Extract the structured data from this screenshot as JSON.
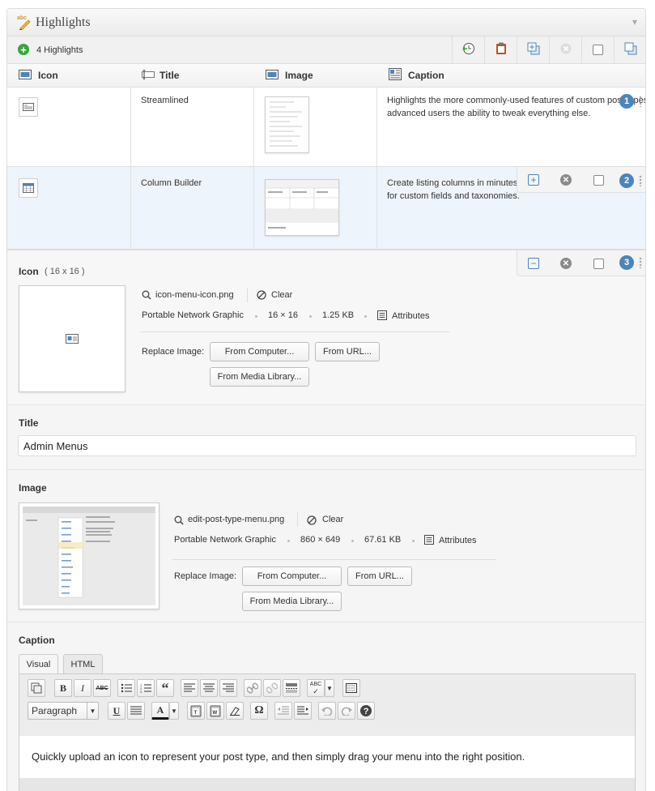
{
  "panel": {
    "title": "Highlights",
    "collapse_glyph": "▾",
    "title_icon": "pencil-icon"
  },
  "toolbar": {
    "add_glyph": "+",
    "count_label": "4 Highlights"
  },
  "columns": {
    "icon": "Icon",
    "title": "Title",
    "image": "Image",
    "caption": "Caption"
  },
  "rows": [
    {
      "number": "1",
      "title": "Streamlined",
      "caption": "Highlights the more commonly-used features of custom post types advanced users the ability to tweak everything else."
    },
    {
      "number": "2",
      "title": "Column Builder",
      "caption": "Create listing columns in minutes for custom fields and taxonomies."
    },
    {
      "number": "3"
    }
  ],
  "edit": {
    "icon_section": {
      "label": "Icon",
      "size_hint": "( 16 x 16 )",
      "filename": "icon-menu-icon.png",
      "clear": "Clear",
      "filetype": "Portable Network Graphic",
      "dimensions": "16 × 16",
      "filesize": "1.25 KB",
      "attributes": "Attributes",
      "replace_label": "Replace Image:",
      "from_computer": "From Computer...",
      "from_url": "From URL...",
      "from_media": "From Media Library..."
    },
    "title_section": {
      "label": "Title",
      "value": "Admin Menus"
    },
    "image_section": {
      "label": "Image",
      "filename": "edit-post-type-menu.png",
      "clear": "Clear",
      "filetype": "Portable Network Graphic",
      "dimensions": "860 × 649",
      "filesize": "67.61 KB",
      "attributes": "Attributes",
      "replace_label": "Replace Image:",
      "from_computer": "From Computer...",
      "from_url": "From URL...",
      "from_media": "From Media Library..."
    },
    "caption_section": {
      "label": "Caption",
      "tab_visual": "Visual",
      "tab_html": "HTML",
      "format_select": "Paragraph",
      "content": "Quickly upload an icon to represent your post type, and then simply drag your menu into the right position."
    }
  },
  "editor_buttons": {
    "bold": "B",
    "italic": "I",
    "strike": "ABC",
    "quote": "“",
    "underline": "U",
    "text_color": "A",
    "omega": "Ω",
    "spell": "ABC"
  },
  "colors": {
    "accent": "#4b85bb",
    "add_green": "#3aa53a",
    "selected_row": "#eef4fb"
  }
}
